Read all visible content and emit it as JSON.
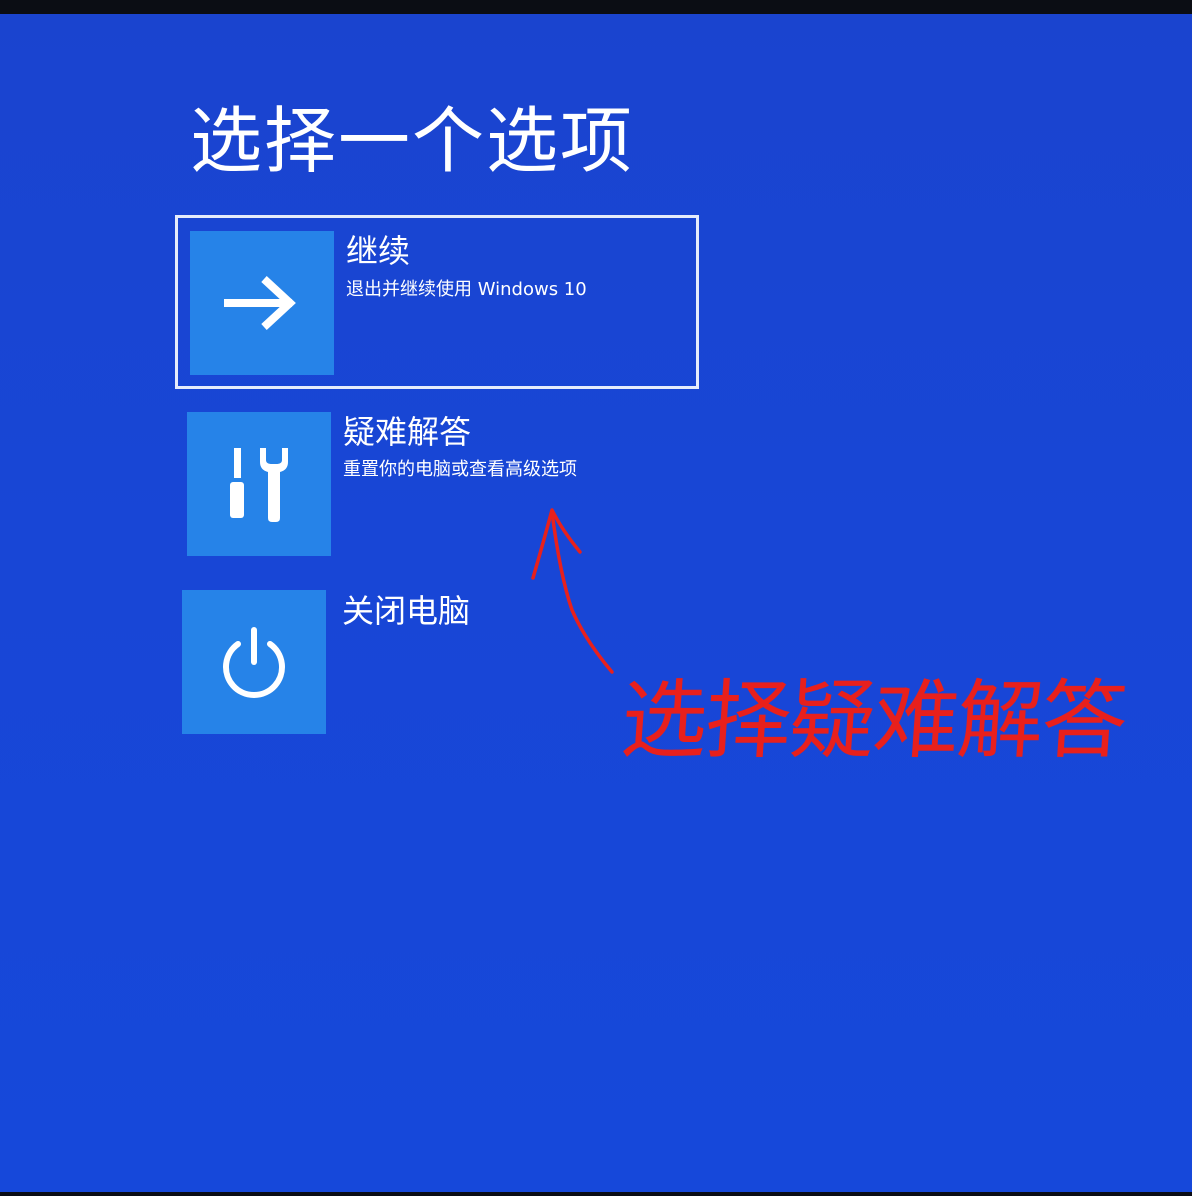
{
  "header": {
    "title": "选择一个选项"
  },
  "options": [
    {
      "title": "继续",
      "description": "退出并继续使用 Windows 10",
      "icon": "arrow-right-icon"
    },
    {
      "title": "疑难解答",
      "description": "重置你的电脑或查看高级选项",
      "icon": "tools-icon"
    },
    {
      "title": "关闭电脑",
      "description": "",
      "icon": "power-icon"
    }
  ],
  "annotation": {
    "text": "选择疑难解答",
    "color": "#e8201c"
  },
  "colors": {
    "background": "#1846d6",
    "tile": "#2683e8",
    "text": "#ffffff"
  }
}
